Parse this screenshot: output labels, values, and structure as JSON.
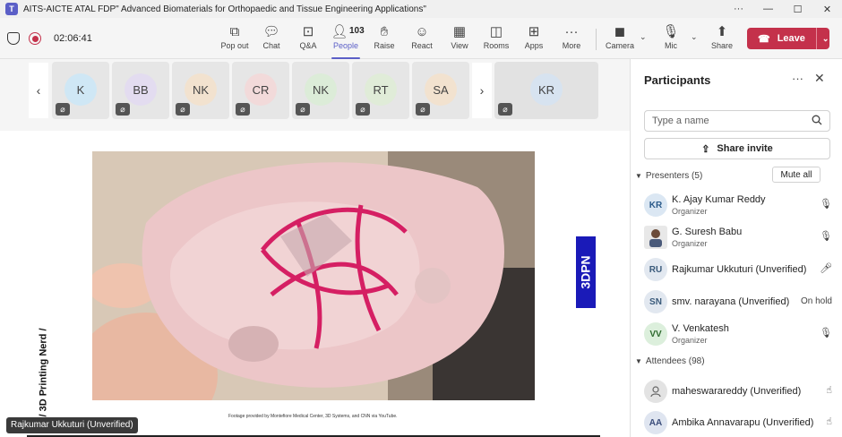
{
  "window": {
    "title": "AITS-AICTE ATAL FDP\" Advanced Biomaterials for Orthopaedic and Tissue Engineering Applications\"",
    "controls": [
      "···",
      "—",
      "☐",
      "✕"
    ]
  },
  "toolbar": {
    "timer": "02:06:41",
    "items": [
      {
        "label": "Pop out",
        "icon": "pop-out-icon"
      },
      {
        "label": "Chat",
        "icon": "chat-icon"
      },
      {
        "label": "Q&A",
        "icon": "qa-icon"
      },
      {
        "label": "People",
        "icon": "people-icon",
        "count": "103",
        "active": true
      },
      {
        "label": "Raise",
        "icon": "raise-hand-icon"
      },
      {
        "label": "React",
        "icon": "react-icon"
      },
      {
        "label": "View",
        "icon": "view-icon"
      },
      {
        "label": "Rooms",
        "icon": "rooms-icon"
      },
      {
        "label": "Apps",
        "icon": "apps-icon"
      },
      {
        "label": "More",
        "icon": "more-icon"
      },
      {
        "label": "Camera",
        "icon": "camera-off-icon"
      },
      {
        "label": "Mic",
        "icon": "mic-off-icon"
      },
      {
        "label": "Share",
        "icon": "share-icon"
      }
    ],
    "leave_label": "Leave",
    "leave_color": "#c4314b",
    "accent_color": "#5b5fc7"
  },
  "stage": {
    "tiles": [
      {
        "initials": "K",
        "color": "#cfe7f5"
      },
      {
        "initials": "BB",
        "color": "#e3dcf0"
      },
      {
        "initials": "NK",
        "color": "#f2e2cf"
      },
      {
        "initials": "CR",
        "color": "#f2dada"
      },
      {
        "initials": "NK",
        "color": "#dcecd8"
      },
      {
        "initials": "RT",
        "color": "#e0ecd8"
      },
      {
        "initials": "SA",
        "color": "#f2e2cf"
      },
      {
        "initials": "KR",
        "color": "#d7e3f0"
      }
    ],
    "brand_label": "3DPN",
    "side_caption": "/ 3D Printing Nerd /",
    "footage_credit": "Footage provided by Montefiore Medical Center, 3D Systems, and CNN via YouTube.",
    "presenter_tag": "Rajkumar Ukkuturi (Unverified)"
  },
  "panel": {
    "title": "Participants",
    "search_placeholder": "Type a name",
    "share_invite": "Share invite",
    "presenters_label": "Presenters (5)",
    "mute_all": "Mute all",
    "attendees_label": "Attendees (98)",
    "presenters": [
      {
        "initials": "KR",
        "name": "K. Ajay Kumar Reddy",
        "role": "Organizer",
        "status": "mic-muted-icon",
        "av_color": "#dbe7f3",
        "av_text": "#2a5a8a"
      },
      {
        "initials": "",
        "name": "G. Suresh Babu",
        "role": "Organizer",
        "status": "mic-muted-icon",
        "av_color": "#e8e8e8",
        "av_text": "#444",
        "photo": true
      },
      {
        "initials": "RU",
        "name": "Rajkumar Ukkuturi (Unverified)",
        "role": "",
        "status": "mic-on-icon",
        "av_color": "#e2e8f0",
        "av_text": "#3b5b7b"
      },
      {
        "initials": "SN",
        "name": "smv. narayana (Unverified)",
        "role": "",
        "status_text": "On hold",
        "av_color": "#e2e8f0",
        "av_text": "#3b5b7b"
      },
      {
        "initials": "VV",
        "name": "V. Venkatesh",
        "role": "Organizer",
        "status": "mic-muted-icon",
        "av_color": "#dcefdc",
        "av_text": "#2f6b2f"
      }
    ],
    "attendees": [
      {
        "initials": "",
        "name": "maheswarareddy (Unverified)",
        "status": "hand-icon",
        "av_color": "#e3e3e3",
        "av_text": "#555",
        "generic": true
      },
      {
        "initials": "AA",
        "name": "Ambika Annavarapu (Unverified)",
        "status": "hand-icon",
        "av_color": "#dfe5f0",
        "av_text": "#3b4d7b"
      }
    ]
  }
}
